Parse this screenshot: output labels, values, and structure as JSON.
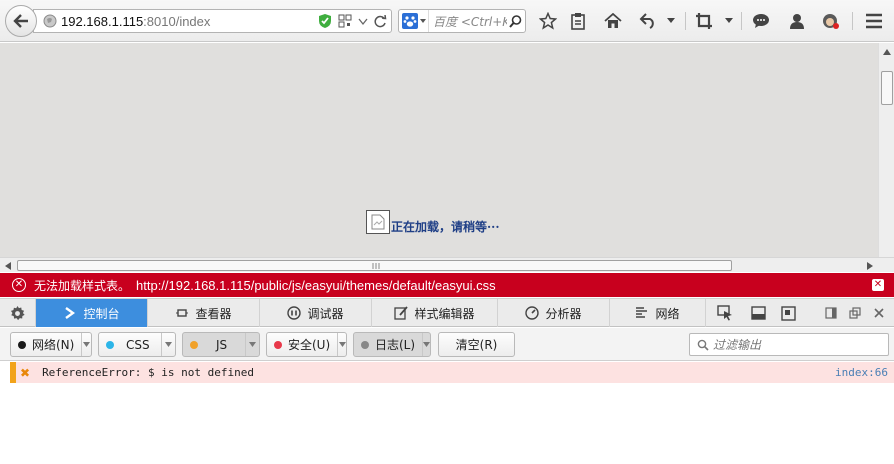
{
  "browser": {
    "url_host": "192.168.1.115",
    "url_rest": ":8010/index",
    "search_placeholder": "百度 <Ctrl+K>"
  },
  "page": {
    "loading_text": "正在加载，请稍等···"
  },
  "error_bar": {
    "message": "无法加载样式表。",
    "url": "http://192.168.1.115/public/js/easyui/themes/default/easyui.css"
  },
  "devtools": {
    "tabs": [
      {
        "label": "控制台",
        "icon": "console-icon",
        "active": true
      },
      {
        "label": "查看器",
        "icon": "inspector-icon"
      },
      {
        "label": "调试器",
        "icon": "debugger-icon"
      },
      {
        "label": "样式编辑器",
        "icon": "style-editor-icon"
      },
      {
        "label": "分析器",
        "icon": "profiler-icon"
      },
      {
        "label": "网络",
        "icon": "network-icon"
      }
    ],
    "filters": {
      "net": "网络(N)",
      "css": "CSS",
      "js": "JS",
      "security": "安全(U)",
      "logging": "日志(L)",
      "clear": "清空(R)",
      "filter_placeholder": "过滤输出"
    },
    "colors": {
      "net": "#1a1a1a",
      "css": "#2cb5e8",
      "js": "#f0a12a",
      "security": "#e8384a",
      "logging": "#888888"
    }
  },
  "console": {
    "messages": [
      {
        "text": "ReferenceError: $ is not defined",
        "location": "index:66"
      }
    ]
  }
}
